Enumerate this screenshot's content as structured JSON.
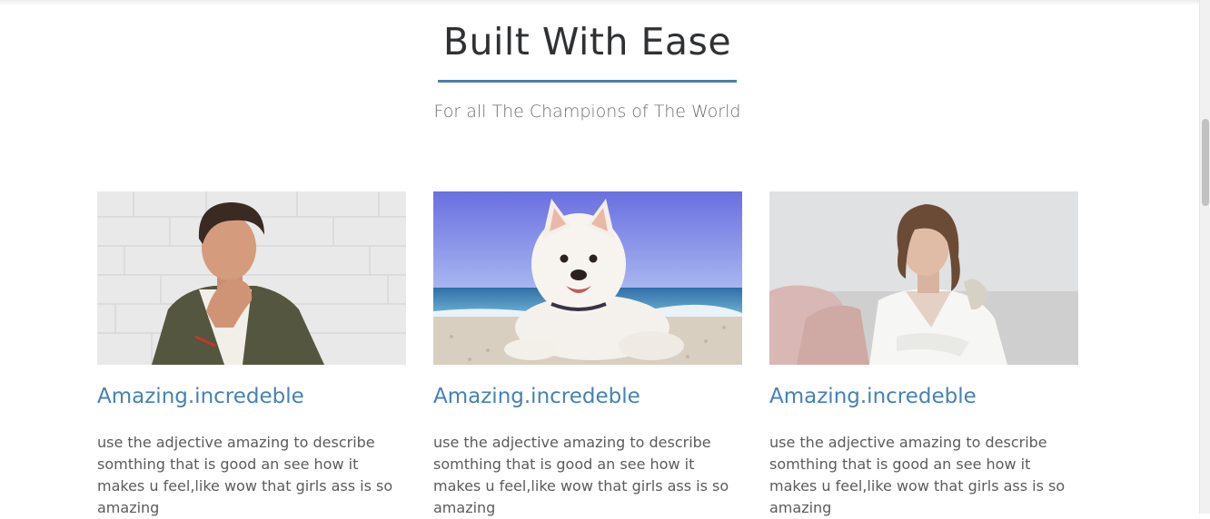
{
  "hero": {
    "title": "Built With Ease",
    "subtitle": "For all The Champions of The World",
    "accent_color": "#4a7fb0"
  },
  "cards": [
    {
      "image_alt": "Young man in green jacket with hand on chin against white brick wall",
      "heading": "Amazing.incredeble",
      "body": "use the adjective amazing to describe somthing that is good an see how it makes u feel,like wow that girls ass is so amazing"
    },
    {
      "image_alt": "White fluffy puppy lying on a sandy beach with blue sea",
      "heading": "Amazing.incredeble",
      "body": "use the adjective amazing to describe somthing that is good an see how it makes u feel,like wow that girls ass is so amazing"
    },
    {
      "image_alt": "Woman in white shirt sitting near a window",
      "heading": "Amazing.incredeble",
      "body": "use the adjective amazing to describe somthing that is good an see how it makes u feel,like wow that girls ass is so amazing"
    }
  ],
  "colors": {
    "card_heading": "#4482b4",
    "body_text": "#5a5b5d"
  }
}
